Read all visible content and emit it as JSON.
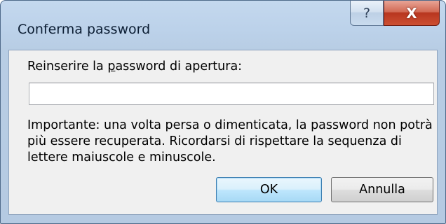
{
  "window": {
    "title": "Conferma password",
    "help_glyph": "?",
    "close_glyph": "X"
  },
  "dialog": {
    "prompt_before": "Reinserire la ",
    "prompt_mnemonic": "p",
    "prompt_after": "assword di apertura:",
    "password_value": "",
    "warning": "Importante: una volta persa o dimenticata, la password non potrà più essere recuperata. Ricordarsi di rispettare la sequenza di lettere maiuscole e minuscole."
  },
  "buttons": {
    "ok_label": "OK",
    "cancel_label": "Annulla"
  },
  "icons": {
    "help": "help-icon",
    "close": "close-icon"
  },
  "colors": {
    "titlebar": "#bcd2ea",
    "close_button": "#c7432b",
    "client_background": "#f0f0f0",
    "default_button_border": "#3c7fb1"
  }
}
